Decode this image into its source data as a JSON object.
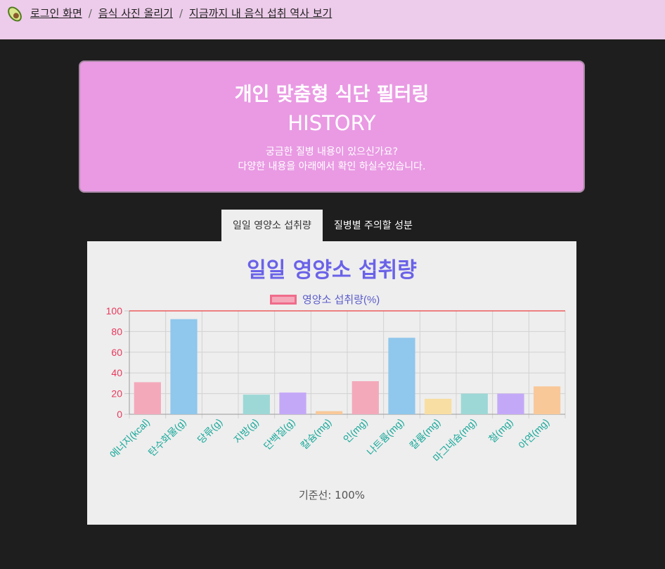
{
  "nav": {
    "logo_icon": "avocado-icon",
    "items": [
      "로그인 화면",
      "음식 사진 올리기",
      "지금까지 내 음식 섭취 역사 보기"
    ],
    "separator": "/"
  },
  "hero": {
    "title": "개인 맞춤형 식단 필터링",
    "subtitle": "HISTORY",
    "line1": "궁금한 질병 내용이 있으신가요?",
    "line2": "다양한 내용을 아래에서 확인 하실수있습니다."
  },
  "tabs": [
    {
      "label": "일일 영양소 섭취량",
      "active": true
    },
    {
      "label": "질병별 주의할 성분",
      "active": false
    }
  ],
  "caption": "기준선: 100%",
  "colors": {
    "title": "#6a62e8",
    "y_tick": "#e8385c",
    "x_tick": "#17a89a",
    "reference_line": "#ee5b5b"
  },
  "chart_data": {
    "type": "bar",
    "title": "일일 영양소 섭취량",
    "categories": [
      "에너지(kcal)",
      "탄수화물(g)",
      "당류(g)",
      "지방(g)",
      "단백질(g)",
      "칼슘(mg)",
      "인(mg)",
      "나트륨(mg)",
      "칼륨(mg)",
      "마그네슘(mg)",
      "철(mg)",
      "아연(mg)"
    ],
    "series": [
      {
        "name": "영양소 섭취량(%)",
        "values": [
          31,
          92,
          0,
          19,
          21,
          3,
          32,
          74,
          15,
          20,
          20,
          27
        ]
      }
    ],
    "bar_colors": [
      "#f4a9ba",
      "#90c7ec",
      "#f4a9ba",
      "#9dd8d6",
      "#c4a8f8",
      "#f9c899",
      "#f4a9ba",
      "#90c7ec",
      "#f8dea3",
      "#9dd8d6",
      "#c4a8f8",
      "#f9c899"
    ],
    "ylim": [
      0,
      100
    ],
    "yticks": [
      0,
      20,
      40,
      60,
      80,
      100
    ],
    "reference_line": 100,
    "grid": true,
    "legend_position": "top"
  }
}
